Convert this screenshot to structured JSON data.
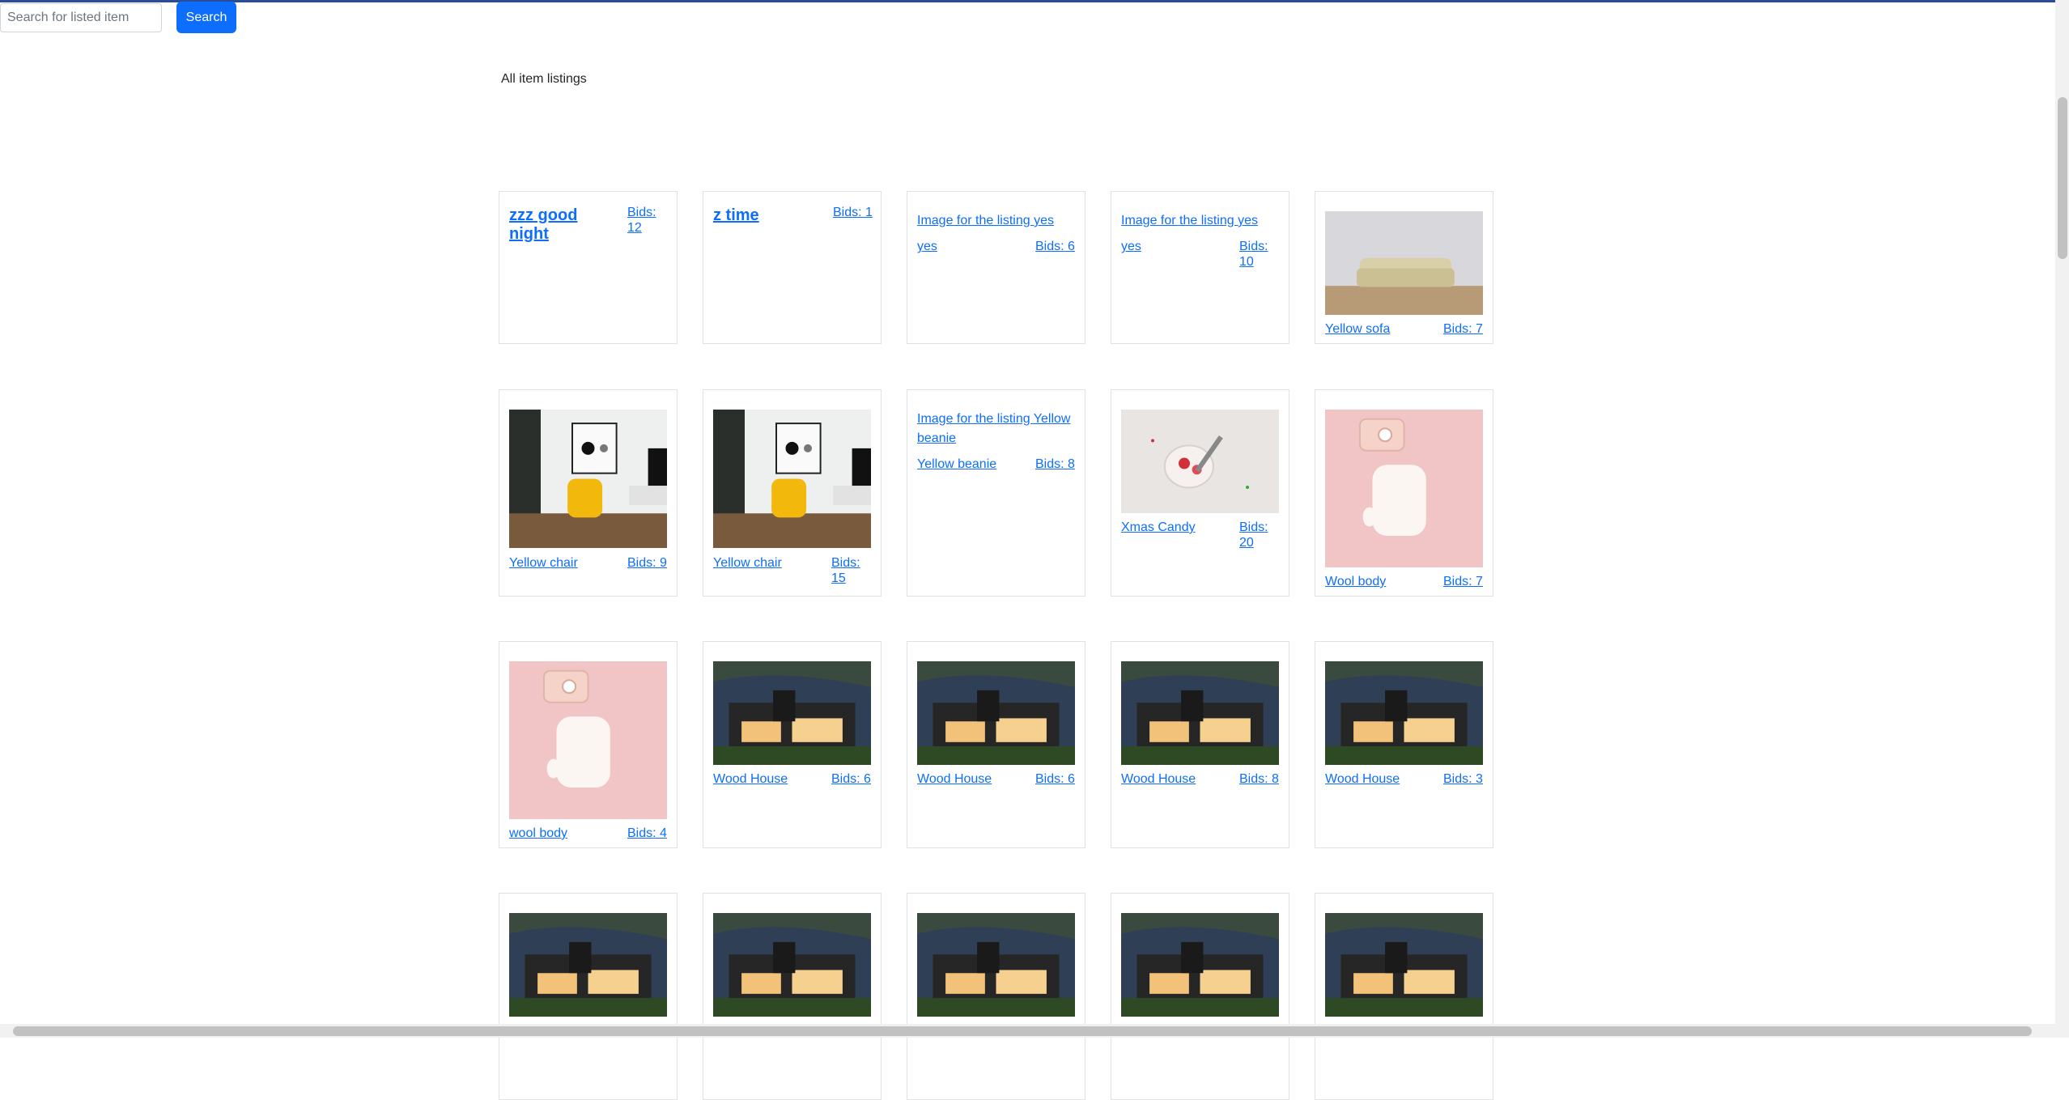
{
  "search": {
    "placeholder": "Search for listed item",
    "button_label": "Search"
  },
  "heading": "All item listings",
  "colors": {
    "link": "#0d6efd",
    "button": "#0d6efd",
    "border": "#dee2e6",
    "topline": "#2a4c9a"
  },
  "listings": [
    {
      "title": "zzz good night",
      "bids": "Bids: 12",
      "image": "none"
    },
    {
      "title": "z time",
      "bids": "Bids: 1",
      "image": "none"
    },
    {
      "title": "yes",
      "bids": "Bids: 6",
      "image": "broken",
      "alt": "Image for the listing yes"
    },
    {
      "title": "yes",
      "bids": "Bids: 10",
      "image": "broken",
      "alt": "Image for the listing yes"
    },
    {
      "title": "Yellow sofa",
      "bids": "Bids: 7",
      "image": "sofa"
    },
    {
      "title": "Yellow chair",
      "bids": "Bids: 9",
      "image": "chair"
    },
    {
      "title": "Yellow chair",
      "bids": "Bids: 15",
      "image": "chair"
    },
    {
      "title": "Yellow beanie",
      "bids": "Bids: 8",
      "image": "broken",
      "alt": "Image for the listing Yellow beanie"
    },
    {
      "title": "Xmas Candy",
      "bids": "Bids: 20",
      "image": "candy"
    },
    {
      "title": "Wool body",
      "bids": "Bids: 7",
      "image": "wool"
    },
    {
      "title": "wool body",
      "bids": "Bids: 4",
      "image": "wool"
    },
    {
      "title": "Wood House",
      "bids": "Bids: 6",
      "image": "house"
    },
    {
      "title": "Wood House",
      "bids": "Bids: 6",
      "image": "house"
    },
    {
      "title": "Wood House",
      "bids": "Bids: 8",
      "image": "house"
    },
    {
      "title": "Wood House",
      "bids": "Bids: 3",
      "image": "house"
    },
    {
      "title": "",
      "bids": "",
      "image": "house"
    },
    {
      "title": "",
      "bids": "",
      "image": "house"
    },
    {
      "title": "",
      "bids": "",
      "image": "house"
    },
    {
      "title": "",
      "bids": "",
      "image": "house"
    },
    {
      "title": "",
      "bids": "",
      "image": "house"
    }
  ]
}
